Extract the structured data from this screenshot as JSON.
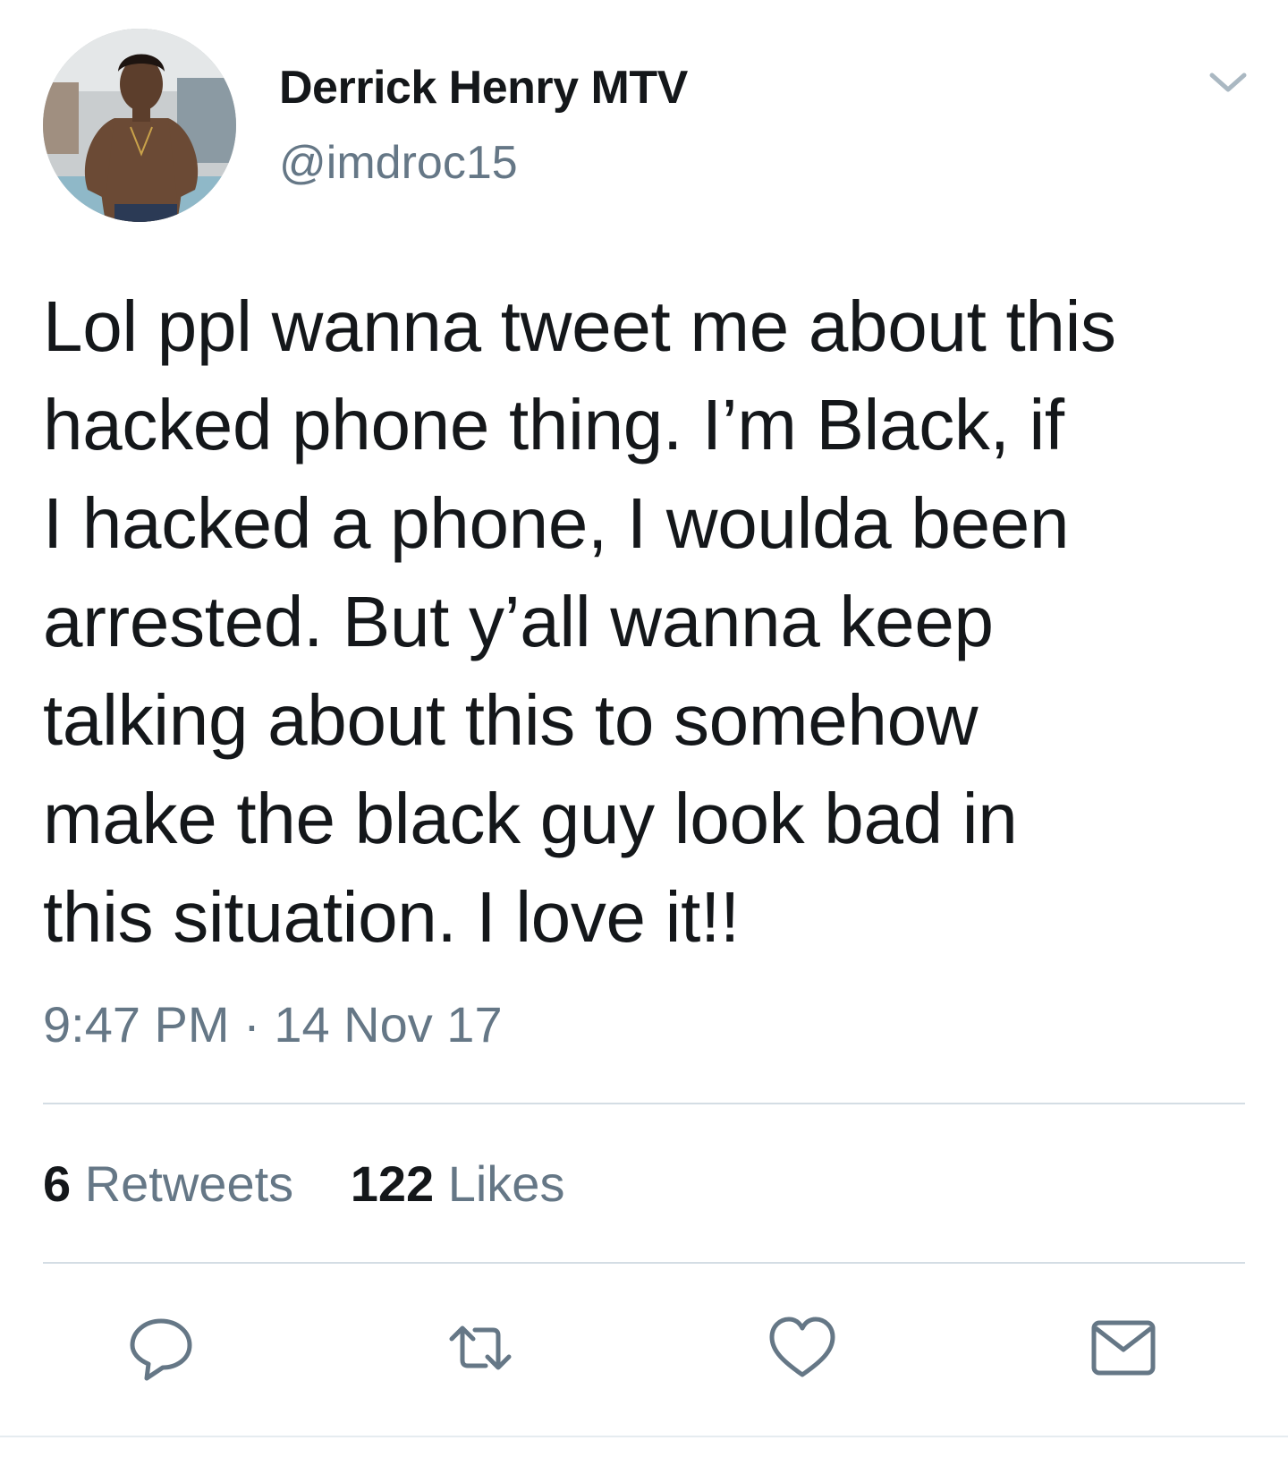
{
  "author": {
    "display_name": "Derrick Henry MTV",
    "handle": "@imdroc15",
    "avatar_icon": "profile-photo"
  },
  "tweet": {
    "lines": [
      "Lol ppl wanna tweet me about this",
      "hacked phone thing. I’m Black, if",
      "I hacked a phone, I woulda been",
      "arrested. But y’all wanna keep",
      "talking about this to somehow",
      "make the black guy look bad in",
      "this situation. I love it!!"
    ],
    "timestamp": "9:47 PM · 14 Nov 17"
  },
  "stats": {
    "retweets_count": "6",
    "retweets_label": "Retweets",
    "likes_count": "122",
    "likes_label": "Likes"
  },
  "actions": {
    "icons": [
      "reply-icon",
      "retweet-icon",
      "like-icon",
      "direct-message-icon"
    ]
  },
  "colors": {
    "text_primary": "#14171a",
    "text_secondary": "#657786",
    "divider": "#d4dde4",
    "icon": "#657786"
  }
}
